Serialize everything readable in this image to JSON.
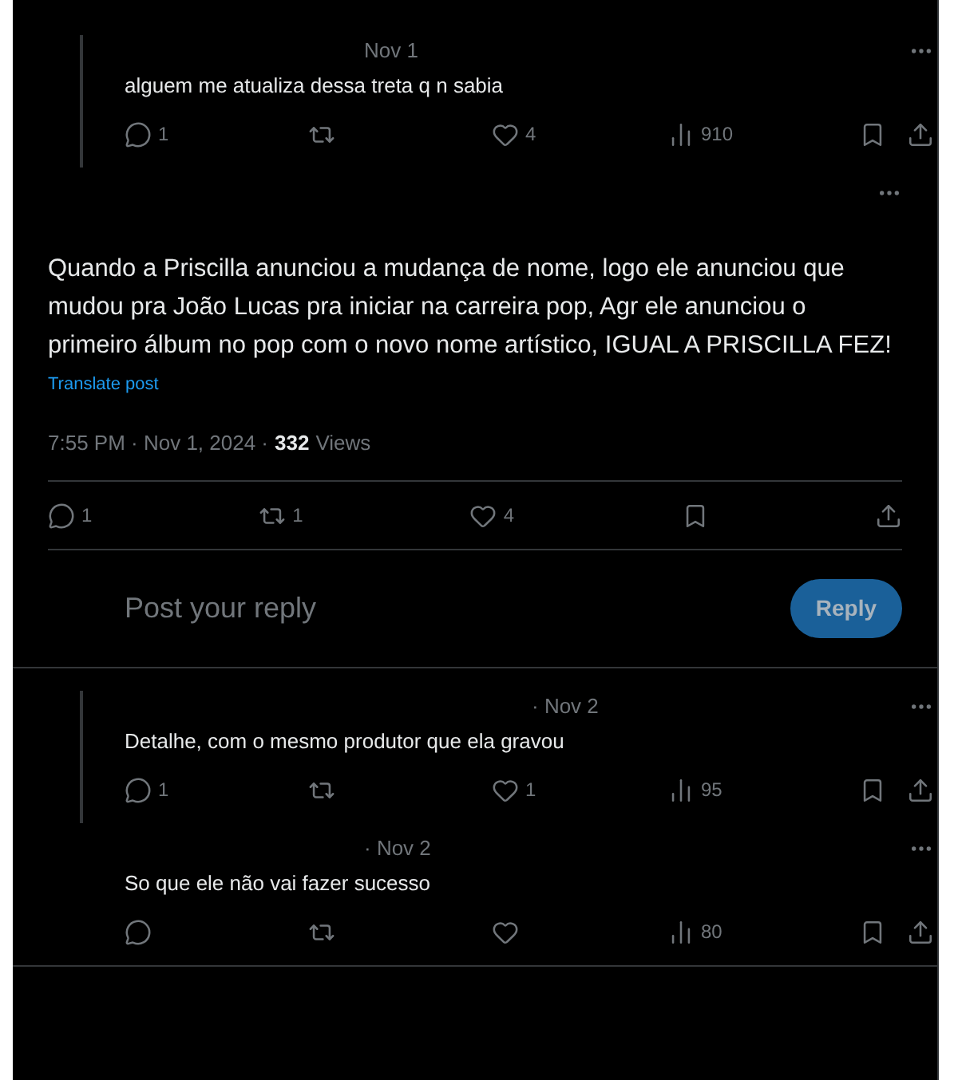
{
  "replies_above": [
    {
      "date": "Nov 1",
      "text": "alguem me atualiza dessa treta q n sabia",
      "connected": true,
      "stats": {
        "replies": "1",
        "likes": "4",
        "views": "910"
      }
    }
  ],
  "main_post": {
    "text": "Quando a Priscilla anunciou a mudança de nome, logo ele anunciou que mudou pra João Lucas pra iniciar na carreira pop, Agr ele anunciou o primeiro álbum no pop com o novo nome artístico, IGUAL A PRISCILLA FEZ!",
    "translate": "Translate post",
    "time": "7:55 PM · Nov 1, 2024 ·",
    "views_count": "332",
    "views_label": "Views",
    "stats": {
      "replies": "1",
      "reposts": "1",
      "likes": "4"
    }
  },
  "reply_box": {
    "placeholder": "Post your reply",
    "button": "Reply"
  },
  "replies_below": [
    {
      "date": "· Nov 2",
      "text": "Detalhe, com o mesmo produtor que ela gravou",
      "connected": true,
      "stats": {
        "replies": "1",
        "likes": "1",
        "views": "95"
      }
    },
    {
      "date": "· Nov 2",
      "text": "So que ele não vai fazer sucesso",
      "connected": false,
      "stats": {
        "views": "80"
      }
    }
  ]
}
